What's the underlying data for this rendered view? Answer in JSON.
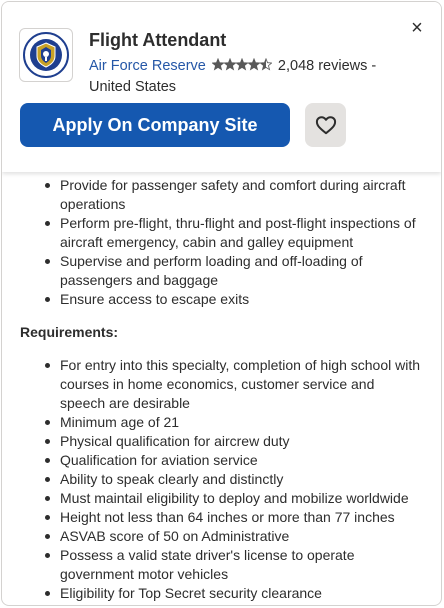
{
  "header": {
    "title": "Flight Attendant",
    "company": "Air Force Reserve",
    "rating_value": 4.5,
    "reviews": "2,048 reviews -",
    "location": "United States",
    "apply_label": "Apply On Company Site",
    "close_glyph": "×",
    "logo_text": "Air Force Reserve Command",
    "icons": {
      "close": "close-icon",
      "save": "heart-icon",
      "rating": "star-rating-icon",
      "logo": "company-logo"
    }
  },
  "responsibilities": [
    "Provide for passenger safety and comfort during aircraft operations",
    "Perform pre-flight, thru-flight and post-flight inspections of aircraft emergency, cabin and galley equipment",
    "Supervise and perform loading and off-loading of passengers and baggage",
    "Ensure access to escape exits"
  ],
  "requirements_heading": "Requirements:",
  "requirements": [
    "For entry into this specialty, completion of high school with courses in home economics, customer service and speech are desirable",
    "Minimum age of 21",
    "Physical qualification for aircrew duty",
    "Qualification for aviation service",
    "Ability to speak clearly and distinctly",
    "Must maintail eligibility to deploy and mobilize worldwide",
    "Height not less than 64 inches or more than 77 inches",
    "ASVAB score of 50 on Administrative",
    "Possess a valid state driver's license to operate government motor vehicles",
    "Eligibility for Top Secret security clearance"
  ],
  "colors": {
    "accent": "#1558b0",
    "link": "#2557a7",
    "text": "#2d2d2d",
    "border": "#d4d2d0",
    "star": "#595959",
    "button_secondary": "#e4e2e0",
    "logo_blue": "#1f3f8f",
    "logo_gold": "#c9a227"
  }
}
